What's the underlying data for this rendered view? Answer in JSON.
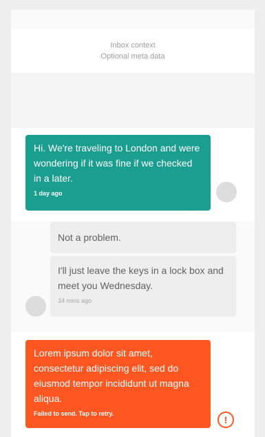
{
  "header": {
    "title": "Inbox context",
    "subtitle": "Optional meta data"
  },
  "messages": [
    {
      "text": "Hi. We're traveling to London and were wondering if it was fine if we checked in a later.",
      "meta": "1 day ago"
    },
    {
      "text": "Not a problem."
    },
    {
      "text": "I'll just leave the keys in a lock box and meet you Wednesday.",
      "meta": "34 mins ago"
    },
    {
      "text": "Lorem ipsum dolor sit amet, consectetur adipiscing elit, sed do eiusmod tempor incididunt ut magna aliqua.",
      "meta": "Failed to send. Tap to retry."
    }
  ],
  "colors": {
    "sent": "#1a9e8f",
    "failed": "#ff5722",
    "received": "#eeeeee"
  },
  "icons": {
    "error": "!"
  }
}
